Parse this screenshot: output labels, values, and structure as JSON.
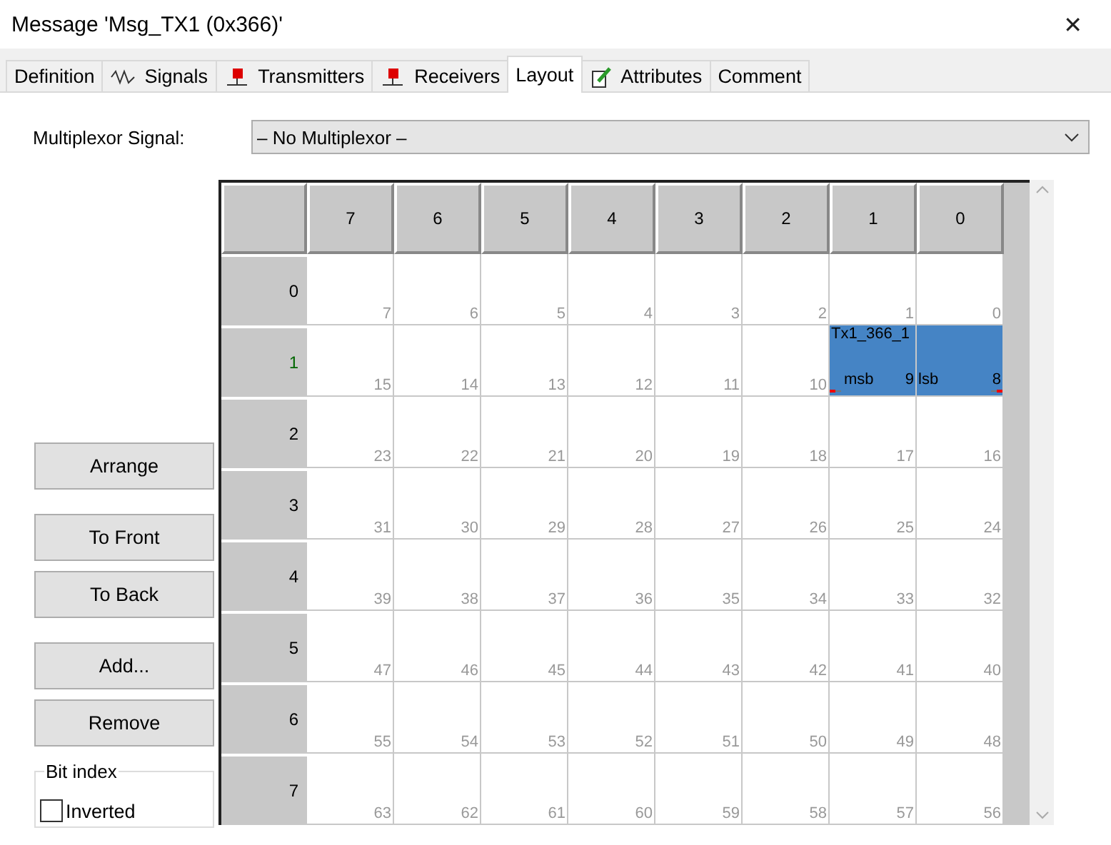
{
  "window": {
    "title": "Message 'Msg_TX1 (0x366)'",
    "close": "✕"
  },
  "tabs": [
    {
      "label": "Definition",
      "selected": false
    },
    {
      "label": "Signals",
      "selected": false
    },
    {
      "label": "Transmitters",
      "selected": false
    },
    {
      "label": "Receivers",
      "selected": false
    },
    {
      "label": "Layout",
      "selected": true
    },
    {
      "label": "Attributes",
      "selected": false
    },
    {
      "label": "Comment",
      "selected": false
    }
  ],
  "multiplexor": {
    "label": "Multiplexor Signal:",
    "value": "– No Multiplexor –"
  },
  "buttons": [
    "Arrange",
    "To Front",
    "To Back",
    "Add...",
    "Remove"
  ],
  "bit_index": {
    "title": "Bit index",
    "inverted": {
      "label": "Inverted",
      "checked": false
    }
  },
  "grid": {
    "columns": [
      "7",
      "6",
      "5",
      "4",
      "3",
      "2",
      "1",
      "0"
    ],
    "rows": [
      {
        "label": "0",
        "cells": [
          {
            "bit": "7"
          },
          {
            "bit": "6"
          },
          {
            "bit": "5"
          },
          {
            "bit": "4"
          },
          {
            "bit": "3"
          },
          {
            "bit": "2"
          },
          {
            "bit": "1"
          },
          {
            "bit": "0"
          }
        ]
      },
      {
        "label": "1",
        "cells": [
          {
            "bit": "15"
          },
          {
            "bit": "14"
          },
          {
            "bit": "13"
          },
          {
            "bit": "12"
          },
          {
            "bit": "11"
          },
          {
            "bit": "10"
          },
          {
            "bit": "9",
            "in_signal": true,
            "signal_name": "Tx1_366_1",
            "end": "msb"
          },
          {
            "bit": "8",
            "in_signal": true,
            "end": "lsb"
          }
        ]
      },
      {
        "label": "2",
        "cells": [
          {
            "bit": "23"
          },
          {
            "bit": "22"
          },
          {
            "bit": "21"
          },
          {
            "bit": "20"
          },
          {
            "bit": "19"
          },
          {
            "bit": "18"
          },
          {
            "bit": "17"
          },
          {
            "bit": "16"
          }
        ]
      },
      {
        "label": "3",
        "cells": [
          {
            "bit": "31"
          },
          {
            "bit": "30"
          },
          {
            "bit": "29"
          },
          {
            "bit": "28"
          },
          {
            "bit": "27"
          },
          {
            "bit": "26"
          },
          {
            "bit": "25"
          },
          {
            "bit": "24"
          }
        ]
      },
      {
        "label": "4",
        "cells": [
          {
            "bit": "39"
          },
          {
            "bit": "38"
          },
          {
            "bit": "37"
          },
          {
            "bit": "36"
          },
          {
            "bit": "35"
          },
          {
            "bit": "34"
          },
          {
            "bit": "33"
          },
          {
            "bit": "32"
          }
        ]
      },
      {
        "label": "5",
        "cells": [
          {
            "bit": "47"
          },
          {
            "bit": "46"
          },
          {
            "bit": "45"
          },
          {
            "bit": "44"
          },
          {
            "bit": "43"
          },
          {
            "bit": "42"
          },
          {
            "bit": "41"
          },
          {
            "bit": "40"
          }
        ]
      },
      {
        "label": "6",
        "cells": [
          {
            "bit": "55"
          },
          {
            "bit": "54"
          },
          {
            "bit": "53"
          },
          {
            "bit": "52"
          },
          {
            "bit": "51"
          },
          {
            "bit": "50"
          },
          {
            "bit": "49"
          },
          {
            "bit": "48"
          }
        ]
      },
      {
        "label": "7",
        "cells": [
          {
            "bit": "63"
          },
          {
            "bit": "62"
          },
          {
            "bit": "61"
          },
          {
            "bit": "60"
          },
          {
            "bit": "59"
          },
          {
            "bit": "58"
          },
          {
            "bit": "57"
          },
          {
            "bit": "56"
          }
        ]
      }
    ]
  }
}
